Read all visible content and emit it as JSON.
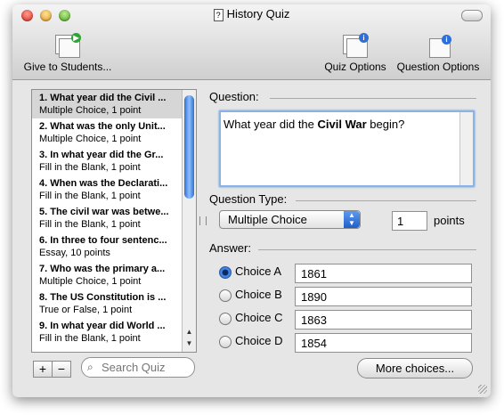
{
  "window": {
    "title": "History Quiz"
  },
  "toolbar": {
    "give_label": "Give to Students...",
    "quiz_options_label": "Quiz Options",
    "question_options_label": "Question Options"
  },
  "questions": [
    {
      "title": "1. What year did the Civil ...",
      "meta": "Multiple Choice, 1 point",
      "selected": true
    },
    {
      "title": "2. What was the only Unit...",
      "meta": "Multiple Choice, 1 point"
    },
    {
      "title": "3. In what year did the Gr...",
      "meta": "Fill in the Blank, 1 point"
    },
    {
      "title": "4. When was the Declarati...",
      "meta": "Fill in the Blank, 1 point"
    },
    {
      "title": "5. The civil war was betwe...",
      "meta": "Fill in the Blank, 1 point"
    },
    {
      "title": "6. In three to four sentenc...",
      "meta": "Essay, 10 points"
    },
    {
      "title": "7. Who was the primary a...",
      "meta": "Multiple Choice, 1 point"
    },
    {
      "title": "8. The US Constitution is ...",
      "meta": "True or False, 1 point"
    },
    {
      "title": "9. In what year did World ...",
      "meta": "Fill in the Blank, 1 point"
    }
  ],
  "list_controls": {
    "add": "+",
    "remove": "−",
    "search_placeholder": "Search Quiz"
  },
  "question": {
    "label": "Question:",
    "text_before": "What year did the ",
    "text_bold": "Civil War",
    "text_after": " begin?"
  },
  "question_type": {
    "label": "Question Type:",
    "value": "Multiple Choice",
    "points": "1",
    "points_label": "points"
  },
  "answer": {
    "label": "Answer:",
    "choices": [
      {
        "label": "Choice A",
        "value": "1861",
        "selected": true
      },
      {
        "label": "Choice B",
        "value": "1890"
      },
      {
        "label": "Choice C",
        "value": "1863"
      },
      {
        "label": "Choice D",
        "value": "1854"
      }
    ],
    "more_label": "More choices..."
  }
}
